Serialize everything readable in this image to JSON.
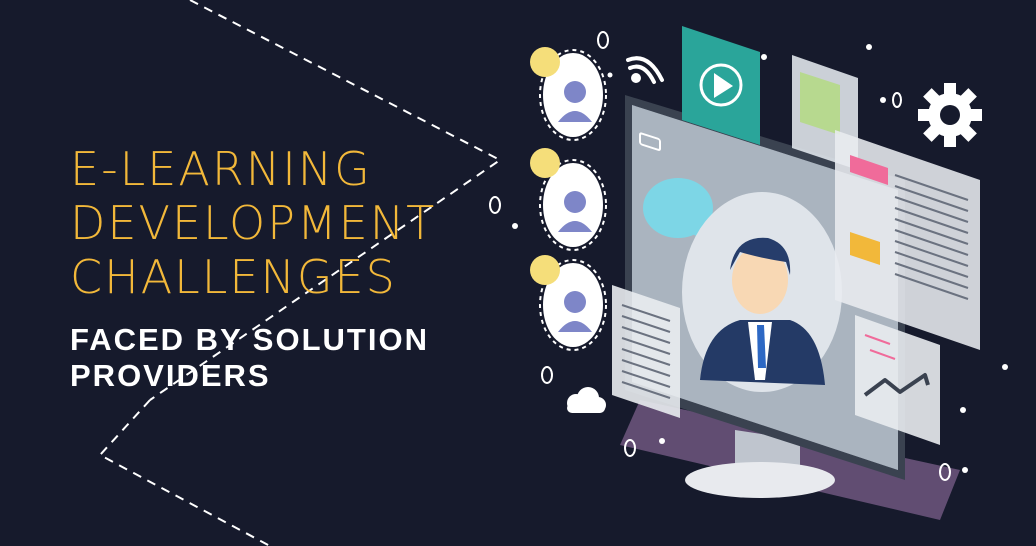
{
  "headline": {
    "line1": "E-LEARNING",
    "line2": "DEVELOPMENT",
    "line3": "CHALLENGES"
  },
  "subhead": {
    "line1": "FACED BY SOLUTION",
    "line2": "PROVIDERS"
  },
  "colors": {
    "background": "#161a2c",
    "headline": "#f2b83a",
    "subhead": "#ffffff",
    "play_card": "#2aa59a",
    "speech_bubble": "#7dd6e6",
    "user_icon": "#7e86c8",
    "chat_dot": "#f5de7a",
    "accent_pink": "#f06b9a",
    "accent_orange": "#f2b83a",
    "accent_green": "#b7d98f"
  },
  "icons": [
    "wifi-icon",
    "play-icon",
    "gear-icon",
    "cloud-icon",
    "battery-icon",
    "trend-chart-icon",
    "user-avatar-icon",
    "speech-bubble-icon"
  ]
}
